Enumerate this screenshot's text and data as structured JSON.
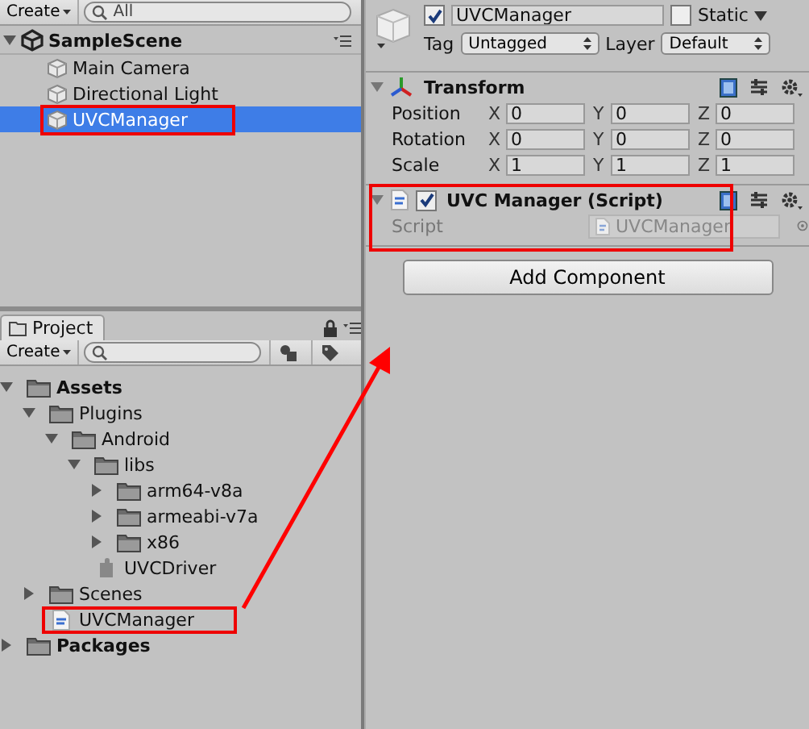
{
  "hierarchy": {
    "create_button": "Create",
    "search": {
      "placeholder": "All"
    },
    "scene": {
      "name": "SampleScene",
      "expanded": true
    },
    "items": [
      {
        "name": "Main Camera",
        "selected": false,
        "highlighted": false
      },
      {
        "name": "Directional Light",
        "selected": false,
        "highlighted": false
      },
      {
        "name": "UVCManager",
        "selected": true,
        "highlighted": true
      }
    ]
  },
  "project": {
    "tab": "Project",
    "create_button": "Create",
    "tree": [
      {
        "name": "Assets",
        "kind": "folder",
        "expanded": true,
        "highlighted": false,
        "children": [
          {
            "name": "Plugins",
            "kind": "folder",
            "expanded": true,
            "highlighted": false,
            "children": [
              {
                "name": "Android",
                "kind": "folder",
                "expanded": true,
                "highlighted": false,
                "children": [
                  {
                    "name": "libs",
                    "kind": "folder",
                    "expanded": true,
                    "highlighted": false,
                    "children": [
                      {
                        "name": "arm64-v8a",
                        "kind": "folder",
                        "expanded": false,
                        "highlighted": false
                      },
                      {
                        "name": "armeabi-v7a",
                        "kind": "folder",
                        "expanded": false,
                        "highlighted": false
                      },
                      {
                        "name": "x86",
                        "kind": "folder",
                        "expanded": false,
                        "highlighted": false
                      }
                    ]
                  },
                  {
                    "name": "UVCDriver",
                    "kind": "plugin",
                    "highlighted": false
                  }
                ]
              }
            ]
          },
          {
            "name": "Scenes",
            "kind": "folder",
            "expanded": false,
            "highlighted": false
          },
          {
            "name": "UVCManager",
            "kind": "script",
            "highlighted": true
          }
        ]
      },
      {
        "name": "Packages",
        "kind": "folder",
        "expanded": false,
        "highlighted": false
      }
    ]
  },
  "inspector": {
    "active": true,
    "name": "UVCManager",
    "static_label": "Static",
    "static": false,
    "tag_label": "Tag",
    "tag": "Untagged",
    "layer_label": "Layer",
    "layer": "Default",
    "components": [
      {
        "kind": "transform",
        "title": "Transform",
        "expanded": true,
        "highlighted": false,
        "rows": [
          {
            "label": "Position",
            "values": [
              {
                "axis": "X",
                "value": "0"
              },
              {
                "axis": "Y",
                "value": "0"
              },
              {
                "axis": "Z",
                "value": "0"
              }
            ]
          },
          {
            "label": "Rotation",
            "values": [
              {
                "axis": "X",
                "value": "0"
              },
              {
                "axis": "Y",
                "value": "0"
              },
              {
                "axis": "Z",
                "value": "0"
              }
            ]
          },
          {
            "label": "Scale",
            "values": [
              {
                "axis": "X",
                "value": "1"
              },
              {
                "axis": "Y",
                "value": "1"
              },
              {
                "axis": "Z",
                "value": "1"
              }
            ]
          }
        ]
      },
      {
        "kind": "script",
        "title": "UVC Manager (Script)",
        "enabled": true,
        "expanded": true,
        "highlighted": true,
        "fields": [
          {
            "label": "Script",
            "value": "UVCManager",
            "disabled": true
          }
        ]
      }
    ],
    "add_component_button": "Add Component"
  }
}
